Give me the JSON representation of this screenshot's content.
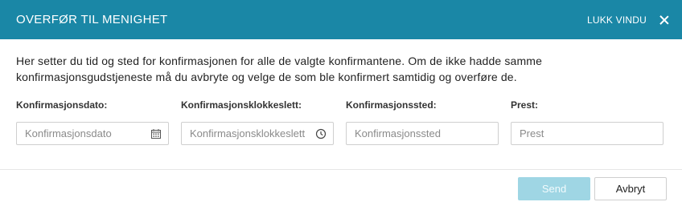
{
  "header": {
    "title": "OVERFØR TIL MENIGHET",
    "close_label": "LUKK VINDU"
  },
  "description": "Her setter du tid og sted for konfirmasjonen for alle de valgte konfirmantene. Om de ikke hadde samme konfirmasjonsgudstjeneste må du avbryte og velge de som ble konfirmert samtidig og overføre de.",
  "fields": [
    {
      "label": "Konfirmasjonsdato:",
      "placeholder": "Konfirmasjonsdato",
      "value": "",
      "icon": "calendar-icon"
    },
    {
      "label": "Konfirmasjonsklokkeslett:",
      "placeholder": "Konfirmasjonsklokkeslett",
      "value": "",
      "icon": "clock-icon"
    },
    {
      "label": "Konfirmasjonssted:",
      "placeholder": "Konfirmasjonssted",
      "value": ""
    },
    {
      "label": "Prest:",
      "placeholder": "Prest",
      "value": ""
    }
  ],
  "footer": {
    "send_label": "Send",
    "cancel_label": "Avbryt"
  },
  "colors": {
    "header_bg": "#1a87a6",
    "send_disabled_bg": "#9fd6e4"
  }
}
